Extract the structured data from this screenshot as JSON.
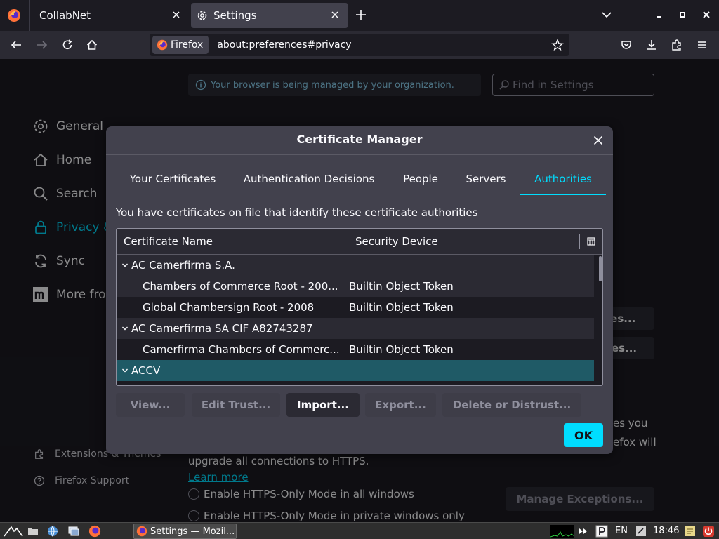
{
  "browser": {
    "tabs": [
      {
        "label": "CollabNet",
        "active": false
      },
      {
        "label": "Settings",
        "active": true
      }
    ],
    "identity_label": "Firefox",
    "url": "about:preferences#privacy"
  },
  "settings": {
    "managed_banner": "Your browser is being managed by your organization.",
    "find_placeholder": "Find in Settings",
    "sidebar": [
      {
        "label": "General",
        "icon": "gear-icon"
      },
      {
        "label": "Home",
        "icon": "home-icon"
      },
      {
        "label": "Search",
        "icon": "search-icon"
      },
      {
        "label": "Privacy &",
        "icon": "lock-icon",
        "selected": true
      },
      {
        "label": "Sync",
        "icon": "sync-icon"
      },
      {
        "label": "More from",
        "icon": "mozilla-icon"
      }
    ],
    "footer": [
      {
        "label": "Extensions & Themes",
        "icon": "puzzle-icon"
      },
      {
        "label": "Firefox Support",
        "icon": "help-icon"
      }
    ],
    "bg_buttons": [
      "tes...",
      "ces..."
    ],
    "bg_text_right_1": "es you",
    "bg_text_right_2": "efox will",
    "https_text": "upgrade all connections to HTTPS.",
    "learn_more": "Learn more",
    "radio_1": "Enable HTTPS-Only Mode in all windows",
    "radio_2": "Enable HTTPS-Only Mode in private windows only",
    "manage_exceptions": "Manage Exceptions..."
  },
  "dialog": {
    "title": "Certificate Manager",
    "tabs": [
      {
        "label": "Your Certificates"
      },
      {
        "label": "Authentication Decisions"
      },
      {
        "label": "People"
      },
      {
        "label": "Servers"
      },
      {
        "label": "Authorities",
        "selected": true
      }
    ],
    "description": "You have certificates on file that identify these certificate authorities",
    "columns": {
      "name": "Certificate Name",
      "device": "Security Device"
    },
    "rows": [
      {
        "type": "group",
        "name": "AC Camerfirma S.A.",
        "device": ""
      },
      {
        "type": "cert",
        "name": "Chambers of Commerce Root - 200...",
        "device": "Builtin Object Token"
      },
      {
        "type": "cert",
        "name": "Global Chambersign Root - 2008",
        "device": "Builtin Object Token"
      },
      {
        "type": "group",
        "name": "AC Camerfirma SA CIF A82743287",
        "device": ""
      },
      {
        "type": "cert",
        "name": "Camerfirma Chambers of Commerc...",
        "device": "Builtin Object Token"
      },
      {
        "type": "group",
        "name": "ACCV",
        "device": "",
        "selected": true
      }
    ],
    "buttons": {
      "view": "View...",
      "edit_trust": "Edit Trust...",
      "import": "Import...",
      "export": "Export...",
      "delete": "Delete or Distrust..."
    },
    "ok": "OK"
  },
  "taskbar": {
    "task_label": "Settings — Mozil...",
    "lang": "EN",
    "clock": "18:46"
  },
  "colors": {
    "accent": "#00ddff",
    "dialog_bg": "#42414d",
    "page_bg": "#1c1b22",
    "selected_row": "#1f5a66"
  }
}
